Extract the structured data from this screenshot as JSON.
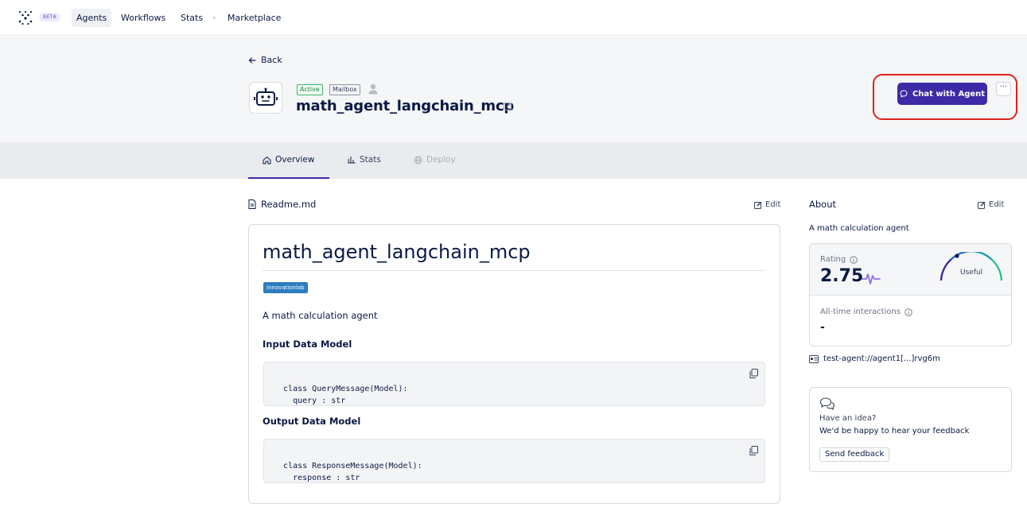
{
  "nav": {
    "badge": "BETA",
    "items": [
      "Agents",
      "Workflows",
      "Stats",
      "Marketplace"
    ]
  },
  "header": {
    "back_label": "Back",
    "status_badge": "Active",
    "mailbox_badge": "Mailbox",
    "agent_name": "math_agent_langchain_mcp",
    "chat_button": "Chat with Agent",
    "more_button": "···"
  },
  "tabs": [
    "Overview",
    "Stats",
    "Deploy"
  ],
  "readme": {
    "label": "Readme.md",
    "edit": "Edit",
    "heading": "math_agent_langchain_mcp",
    "tag": "innovationlab",
    "description": "A math calculation agent",
    "input_heading": "Input Data Model",
    "input_code": "class QueryMessage(Model):\n    query : str",
    "output_heading": "Output Data Model",
    "output_code": "class ResponseMessage(Model):\n    response : str"
  },
  "about": {
    "label": "About",
    "edit": "Edit",
    "description": "A math calculation agent",
    "rating_label": "Rating",
    "rating_value": "2.75",
    "gauge_label": "Useful",
    "interactions_label": "All-time interactions",
    "interactions_value": "-",
    "address": "test-agent://agent1[...]rvg6m"
  },
  "feedback": {
    "question": "Have an idea?",
    "text": "We'd be happy to hear your feedback",
    "button": "Send feedback"
  },
  "colors": {
    "accent": "#3d2aa6",
    "highlight": "#e0211c",
    "active_green": "#1a8a3f"
  }
}
